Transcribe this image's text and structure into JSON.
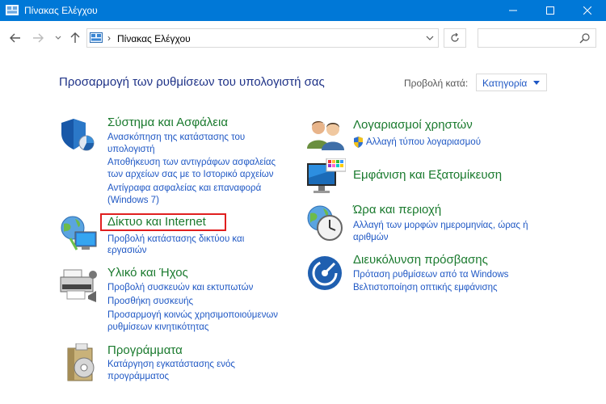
{
  "window": {
    "title": "Πίνακας Ελέγχου"
  },
  "address": {
    "breadcrumb": "Πίνακας Ελέγχου",
    "search_placeholder": ""
  },
  "header": {
    "title": "Προσαρμογή των ρυθμίσεων του υπολογιστή σας",
    "view_by_label": "Προβολή κατά:",
    "view_by_value": "Κατηγορία"
  },
  "categories": {
    "system": {
      "title": "Σύστημα και Ασφάλεια",
      "links": [
        "Ανασκόπηση της κατάστασης του",
        "υπολογιστή",
        "Αποθήκευση των αντιγράφων ασφαλείας",
        "των αρχείων σας με το Ιστορικό αρχείων",
        "Αντίγραφα ασφαλείας και επαναφορά",
        "(Windows 7)"
      ]
    },
    "network": {
      "title": "Δίκτυο και Internet",
      "links": [
        "Προβολή κατάστασης δικτύου και",
        "εργασιών"
      ]
    },
    "hardware": {
      "title": "Υλικό και Ήχος",
      "links": [
        "Προβολή συσκευών και εκτυπωτών",
        "Προσθήκη συσκευής",
        "Προσαρμογή κοινώς χρησιμοποιούμενων",
        "ρυθμίσεων κινητικότητας"
      ]
    },
    "programs": {
      "title": "Προγράμματα",
      "links": [
        "Κατάργηση εγκατάστασης ενός",
        "προγράμματος"
      ]
    },
    "users": {
      "title": "Λογαριασμοί χρηστών",
      "links": [
        "Αλλαγή τύπου λογαριασμού"
      ]
    },
    "appearance": {
      "title": "Εμφάνιση και Εξατομίκευση",
      "links": []
    },
    "clock": {
      "title": "Ώρα και περιοχή",
      "links": [
        "Αλλαγή των μορφών ημερομηνίας, ώρας ή",
        "αριθμών"
      ]
    },
    "ease": {
      "title": "Διευκόλυνση πρόσβασης",
      "links": [
        "Πρόταση ρυθμίσεων από τα Windows",
        "Βελτιστοποίηση οπτικής εμφάνισης"
      ]
    }
  },
  "colors": {
    "titlebar": "#0078d7",
    "category_title": "#1a7a2e",
    "link": "#1e57c4",
    "highlight": "#e01f1f"
  }
}
